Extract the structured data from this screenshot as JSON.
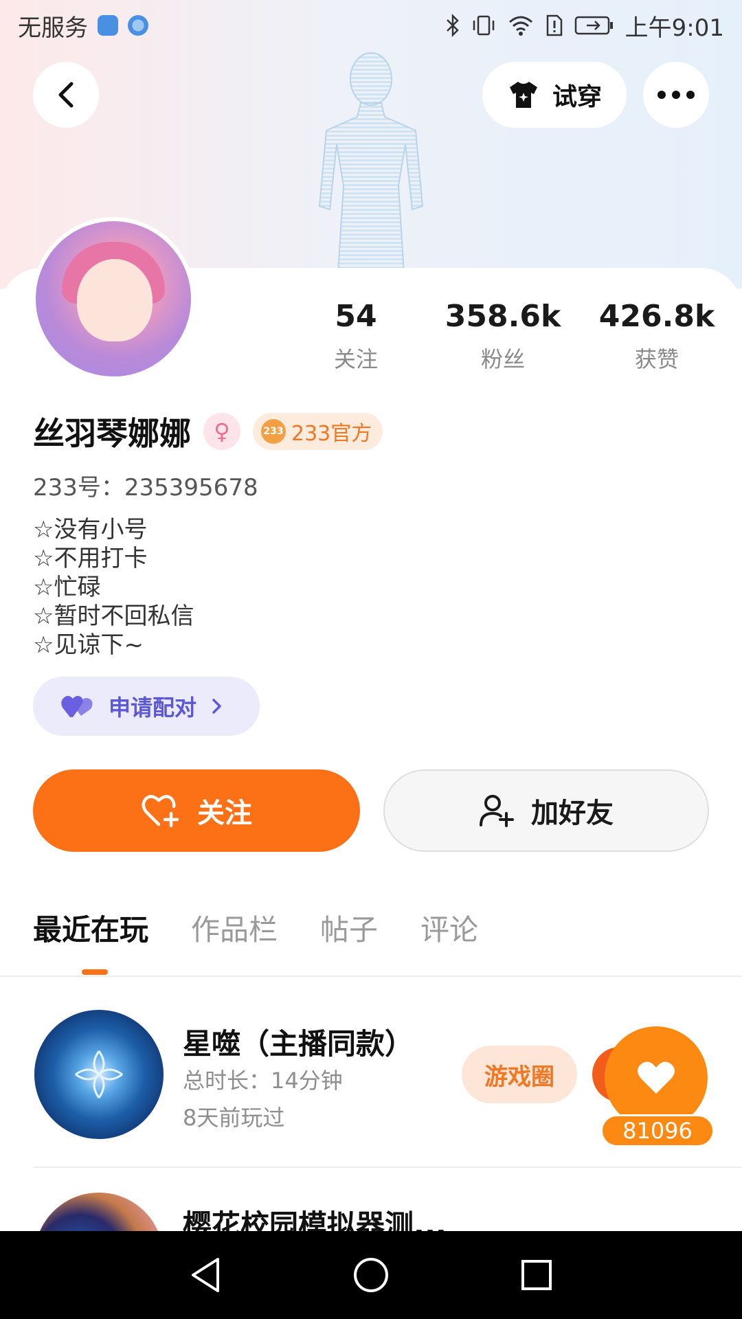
{
  "status_bar": {
    "carrier": "无服务",
    "time": "上午9:01"
  },
  "header": {
    "try_on_label": "试穿"
  },
  "profile": {
    "name": "丝羽琴娜娜",
    "official_badge": "233官方",
    "uid": "233号：235395678",
    "bio": [
      "☆没有小号",
      "☆不用打卡",
      "☆忙碌",
      "☆暂时不回私信",
      "☆见谅下~"
    ],
    "stats": [
      {
        "value": "54",
        "label": "关注"
      },
      {
        "value": "358.6k",
        "label": "粉丝"
      },
      {
        "value": "426.8k",
        "label": "获赞"
      }
    ]
  },
  "actions": {
    "pair_label": "申请配对",
    "follow_label": "关注",
    "add_friend_label": "加好友"
  },
  "tabs": [
    "最近在玩",
    "作品栏",
    "帖子",
    "评论"
  ],
  "games": [
    {
      "title": "星噬（主播同款）",
      "duration": "总时长：14分钟",
      "last_played": "8天前玩过",
      "circle_label": "游戏圈"
    },
    {
      "title": "樱花校园模拟器测..."
    }
  ],
  "like_count": "81096",
  "colors": {
    "accent": "#fc7115",
    "pair_text": "#5c58d6",
    "official": "#f07822"
  }
}
